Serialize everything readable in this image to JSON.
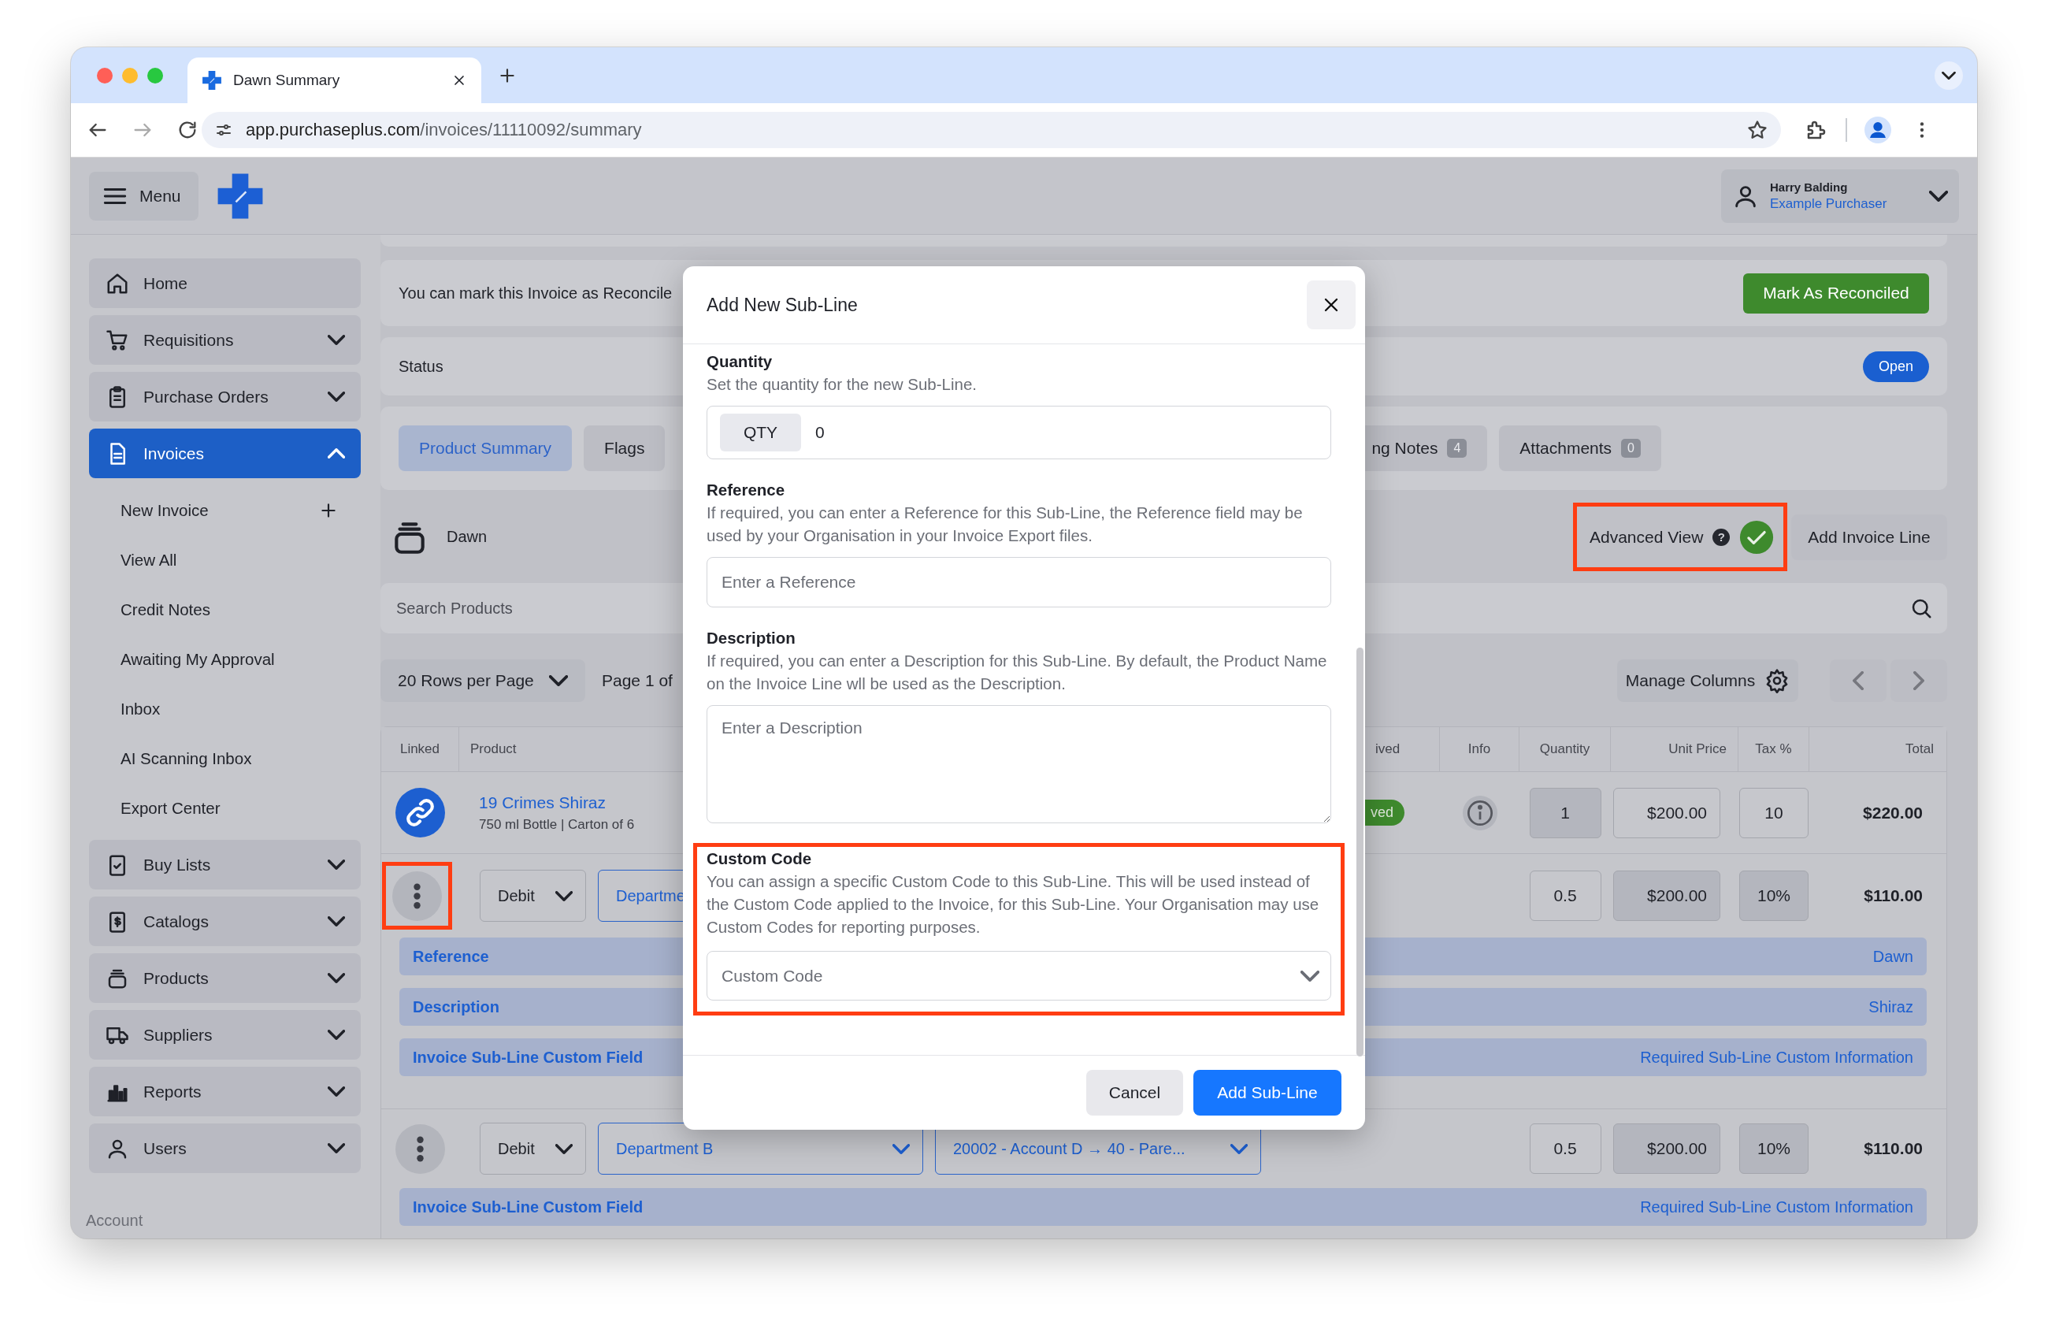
{
  "browser": {
    "tab_title": "Dawn Summary",
    "url_host": "app.purchaseplus.com",
    "url_path": "/invoices/11110092/summary"
  },
  "header": {
    "menu_label": "Menu",
    "user_name": "Harry Balding",
    "user_role": "Example Purchaser"
  },
  "sidebar": {
    "items": [
      {
        "label": "Home",
        "kind": "link",
        "selected": false
      },
      {
        "label": "Requisitions",
        "kind": "menu",
        "selected": false,
        "expanded": false
      },
      {
        "label": "Purchase Orders",
        "kind": "menu",
        "selected": false,
        "expanded": false
      },
      {
        "label": "Invoices",
        "kind": "menu",
        "selected": true,
        "expanded": true,
        "children": [
          {
            "label": "New Invoice",
            "kind": "action",
            "selected": false
          },
          {
            "label": "View All",
            "kind": "link",
            "selected": false
          },
          {
            "label": "Credit Notes",
            "kind": "link",
            "selected": false
          },
          {
            "label": "Awaiting My Approval",
            "kind": "link",
            "selected": false
          },
          {
            "label": "Inbox",
            "kind": "link",
            "selected": false
          },
          {
            "label": "AI Scanning Inbox",
            "kind": "link",
            "selected": false
          },
          {
            "label": "Export Center",
            "kind": "link",
            "selected": false
          }
        ]
      },
      {
        "label": "Buy Lists",
        "kind": "menu",
        "selected": false,
        "expanded": false
      },
      {
        "label": "Catalogs",
        "kind": "menu",
        "selected": false,
        "expanded": false
      },
      {
        "label": "Products",
        "kind": "menu",
        "selected": false,
        "expanded": false
      },
      {
        "label": "Suppliers",
        "kind": "menu",
        "selected": false,
        "expanded": false
      },
      {
        "label": "Reports",
        "kind": "menu",
        "selected": false,
        "expanded": false
      },
      {
        "label": "Users",
        "kind": "menu",
        "selected": false,
        "expanded": false
      }
    ],
    "section_label": "Account"
  },
  "reconcile": {
    "message": "You can mark this Invoice as Reconcile",
    "button": "Mark As Reconciled"
  },
  "status": {
    "label": "Status",
    "badge": "Open"
  },
  "tabs": [
    {
      "label": "Product Summary",
      "selected": true
    },
    {
      "label": "Flags",
      "selected": false
    },
    {
      "label": "ng Notes",
      "count": "4",
      "selected": false
    },
    {
      "label": "Attachments",
      "count": "0",
      "selected": false
    }
  ],
  "supplier": "Dawn",
  "advanced_view": {
    "label": "Advanced View",
    "help_glyph": "?",
    "checked": true,
    "highlighted": true
  },
  "add_line_button": "Add Invoice Line",
  "search": {
    "placeholder": "Search Products"
  },
  "pagination": {
    "rows_per_page": "20 Rows per Page",
    "page": "Page 1 of",
    "manage_columns": "Manage Columns"
  },
  "table": {
    "columns": [
      "Linked",
      "Product",
      "ived",
      "Info",
      "Quantity",
      "Unit Price",
      "Tax %",
      "Total"
    ],
    "rows": [
      {
        "kind": "line",
        "linked": true,
        "product": "19 Crimes Shiraz",
        "detail": "750 ml Bottle | Carton of 6",
        "status": "ved",
        "quantity": {
          "value": "1",
          "disabled": true
        },
        "unit_price": {
          "value": "$200.00",
          "disabled": false
        },
        "tax": {
          "value": "10",
          "disabled": false
        },
        "total": "$220.00"
      },
      {
        "kind": "subline",
        "highlighted": true,
        "type": "Debit",
        "department": "Departme",
        "quantity": {
          "value": "0.5",
          "disabled": false
        },
        "unit_price": {
          "value": "$200.00",
          "disabled": true
        },
        "tax": {
          "value": "10%",
          "disabled": true
        },
        "total": "$110.00",
        "fields": [
          {
            "label": "Reference",
            "value": "Dawn"
          },
          {
            "label": "Description",
            "value": "Shiraz"
          },
          {
            "label": "Invoice Sub-Line Custom Field",
            "value": "Required Sub-Line Custom Information"
          }
        ]
      },
      {
        "kind": "subline",
        "highlighted": false,
        "type": "Debit",
        "department": "Department B",
        "account": "20002 - Account D → 40 - Pare...",
        "quantity": {
          "value": "0.5",
          "disabled": false
        },
        "unit_price": {
          "value": "$200.00",
          "disabled": true
        },
        "tax": {
          "value": "10%",
          "disabled": true
        },
        "total": "$110.00",
        "fields": [
          {
            "label": "Invoice Sub-Line Custom Field",
            "value": "Required Sub-Line Custom Information"
          }
        ]
      }
    ]
  },
  "dialog": {
    "title": "Add New Sub-Line",
    "sections": [
      {
        "kind": "quantity",
        "label": "Quantity",
        "hint": "Set the quantity for the new Sub-Line.",
        "addon": "QTY",
        "value": "0",
        "highlighted": false
      },
      {
        "kind": "text",
        "label": "Reference",
        "hint": "If required, you can enter a Reference for this Sub-Line, the Reference field may be used by your Organisation in your Invoice Export files.",
        "placeholder": "Enter a Reference",
        "highlighted": false
      },
      {
        "kind": "textarea",
        "label": "Description",
        "hint": "If required, you can enter a Description for this Sub-Line. By default, the Product Name on the Invoice Line wll be used as the Description.",
        "placeholder": "Enter a Description",
        "highlighted": false
      },
      {
        "kind": "select",
        "label": "Custom Code",
        "hint": "You can assign a specific Custom Code to this Sub-Line. This will be used instead of the Custom Code applied to the Invoice, for this Sub-Line. Your Organisation may use Custom Codes for reporting purposes.",
        "placeholder": "Custom Code",
        "highlighted": true
      }
    ],
    "buttons": [
      {
        "label": "Cancel",
        "kind": "secondary"
      },
      {
        "label": "Add Sub-Line",
        "kind": "primary"
      }
    ]
  }
}
